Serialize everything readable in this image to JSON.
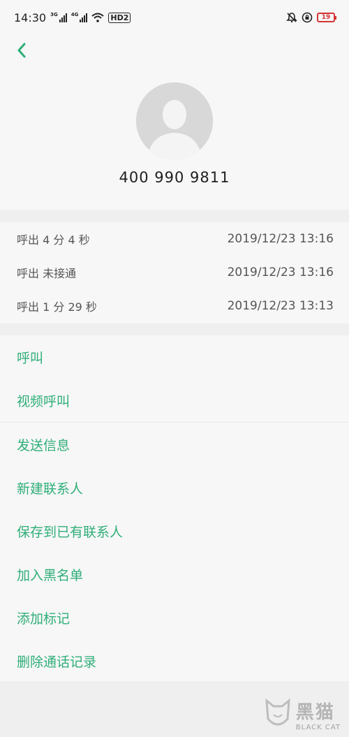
{
  "status_bar": {
    "time": "14:30",
    "net1": "3G",
    "net2": "4G",
    "hd": "HD2",
    "battery": "19"
  },
  "header": {
    "back_icon": "chevron-left-icon",
    "avatar_icon": "person-silhouette-icon",
    "phone_number": "400 990 9811"
  },
  "call_log": [
    {
      "type": "呼出  4 分 4 秒",
      "datetime": "2019/12/23 13:16"
    },
    {
      "type": "呼出 未接通",
      "datetime": "2019/12/23 13:16"
    },
    {
      "type": "呼出  1 分 29 秒",
      "datetime": "2019/12/23 13:13"
    }
  ],
  "actions": {
    "call": "呼叫",
    "video_call": "视频呼叫",
    "send_message": "发送信息",
    "new_contact": "新建联系人",
    "save_existing": "保存到已有联系人",
    "block": "加入黑名单",
    "add_tag": "添加标记",
    "delete_log": "删除通话记录"
  },
  "watermark": {
    "cn": "黑猫",
    "en": "BLACK CAT"
  },
  "colors": {
    "accent": "#2fae78",
    "battery_low": "#d53434"
  }
}
